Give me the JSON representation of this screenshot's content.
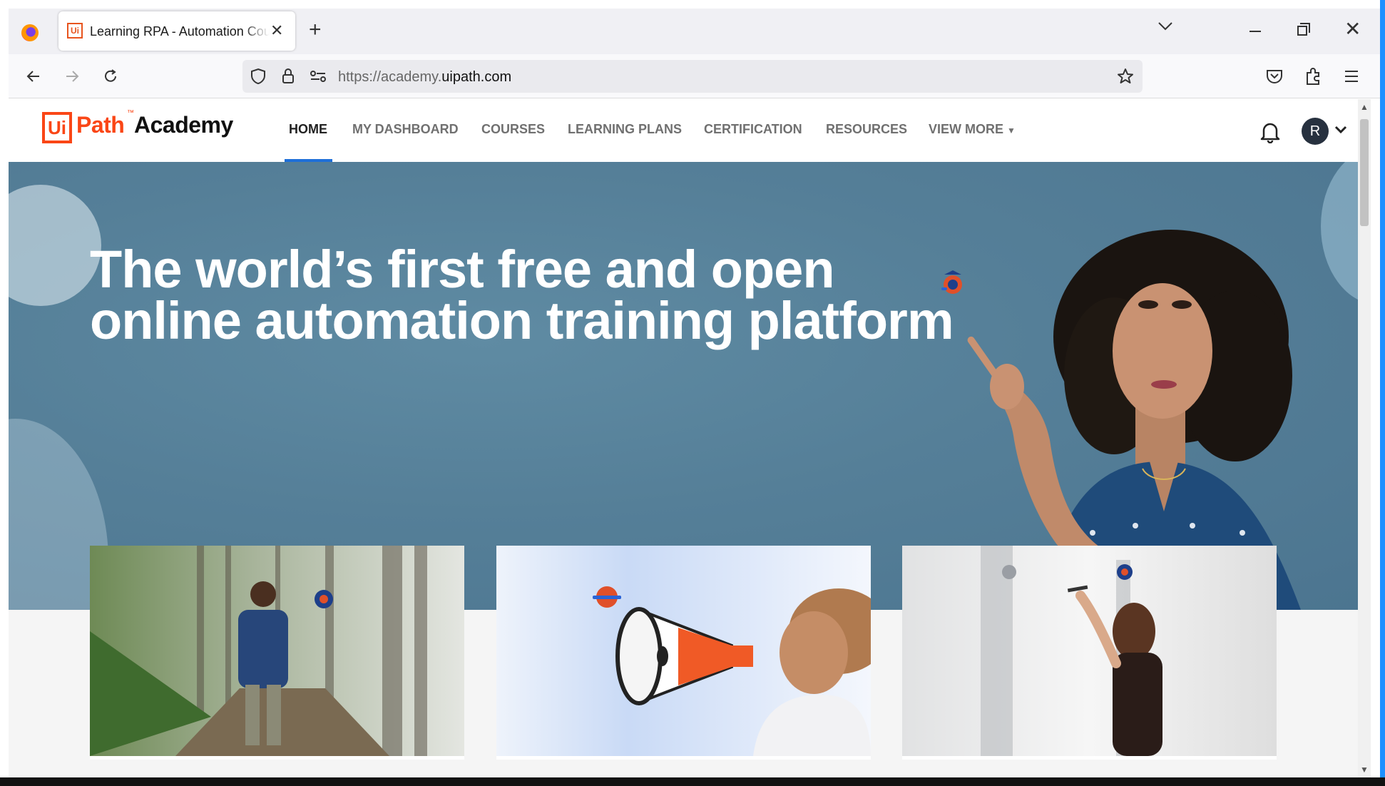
{
  "browser": {
    "tab_title": "Learning RPA - Automation Courses",
    "tab_favicon_text": "Ui",
    "url_prefix": "https://academy.",
    "url_domain": "uipath.com",
    "icons": [
      "firefox-icon",
      "close-icon",
      "plus-icon",
      "chevron-down-icon",
      "minimize-icon",
      "restore-icon",
      "back-icon",
      "forward-icon",
      "reload-icon",
      "shield-icon",
      "lock-icon",
      "permissions-icon",
      "star-icon",
      "pocket-icon",
      "extensions-icon",
      "menu-icon"
    ]
  },
  "header": {
    "logo_ui": "Ui",
    "logo_path": "Path",
    "logo_tm": "™",
    "logo_academy": "Academy",
    "menu": [
      {
        "label": "HOME",
        "active": true
      },
      {
        "label": "MY DASHBOARD"
      },
      {
        "label": "COURSES"
      },
      {
        "label": "LEARNING PLANS"
      },
      {
        "label": "CERTIFICATION"
      },
      {
        "label": "RESOURCES"
      },
      {
        "label": "VIEW MORE"
      }
    ],
    "avatar_initial": "R"
  },
  "hero": {
    "headline_line1": "The world’s first free and open",
    "headline_line2": "online automation training platform"
  },
  "colors": {
    "brand_orange": "#fa4616",
    "active_underline": "#1e6fd9",
    "hero_bg": "#557f98"
  }
}
